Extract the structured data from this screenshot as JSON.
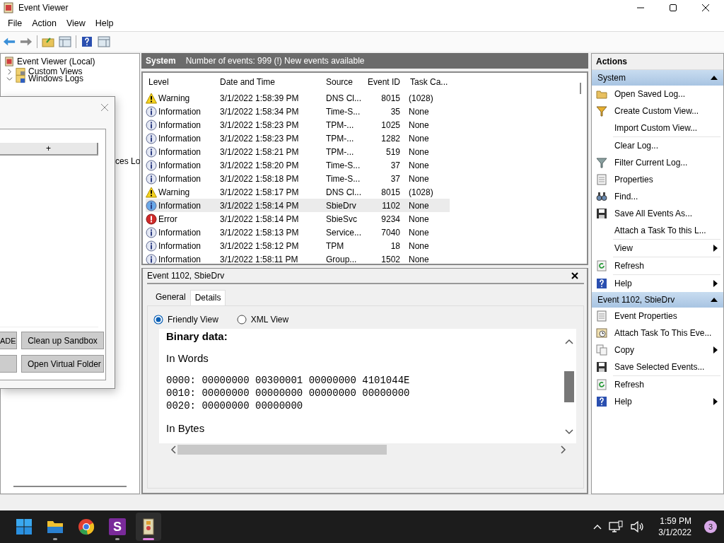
{
  "window": {
    "title": "Event Viewer"
  },
  "menu": [
    "File",
    "Action",
    "View",
    "Help"
  ],
  "tree": {
    "label": "Event Viewer (Local)",
    "children": [
      {
        "label": "Custom Views",
        "expanded": false
      },
      {
        "label": "Windows Logs",
        "expanded": true
      }
    ]
  },
  "tree_fragment": "ces Lo",
  "dialog": {
    "column_header": "+",
    "left_buttons": [
      "ADE"
    ],
    "right_buttons": [
      "Clean up Sandbox",
      "Open Virtual Folder"
    ]
  },
  "log": {
    "name": "System",
    "summary": "Number of events: 999 (!) New events available"
  },
  "table": {
    "columns": [
      "Level",
      "Date and Time",
      "Source",
      "Event ID",
      "Task Ca..."
    ],
    "rows": [
      {
        "kind": "warning",
        "level": "Warning",
        "date": "3/1/2022 1:58:39 PM",
        "source": "DNS Cl...",
        "event_id": "8015",
        "task": "(1028)",
        "selected": false
      },
      {
        "kind": "information",
        "level": "Information",
        "date": "3/1/2022 1:58:34 PM",
        "source": "Time-S...",
        "event_id": "35",
        "task": "None",
        "selected": false
      },
      {
        "kind": "information",
        "level": "Information",
        "date": "3/1/2022 1:58:23 PM",
        "source": "TPM-...",
        "event_id": "1025",
        "task": "None",
        "selected": false
      },
      {
        "kind": "information",
        "level": "Information",
        "date": "3/1/2022 1:58:23 PM",
        "source": "TPM-...",
        "event_id": "1282",
        "task": "None",
        "selected": false
      },
      {
        "kind": "information",
        "level": "Information",
        "date": "3/1/2022 1:58:21 PM",
        "source": "TPM-...",
        "event_id": "519",
        "task": "None",
        "selected": false
      },
      {
        "kind": "information",
        "level": "Information",
        "date": "3/1/2022 1:58:20 PM",
        "source": "Time-S...",
        "event_id": "37",
        "task": "None",
        "selected": false
      },
      {
        "kind": "information",
        "level": "Information",
        "date": "3/1/2022 1:58:18 PM",
        "source": "Time-S...",
        "event_id": "37",
        "task": "None",
        "selected": false
      },
      {
        "kind": "warning",
        "level": "Warning",
        "date": "3/1/2022 1:58:17 PM",
        "source": "DNS Cl...",
        "event_id": "8015",
        "task": "(1028)",
        "selected": false
      },
      {
        "kind": "information",
        "level": "Information",
        "date": "3/1/2022 1:58:14 PM",
        "source": "SbieDrv",
        "event_id": "1102",
        "task": "None",
        "selected": true
      },
      {
        "kind": "error",
        "level": "Error",
        "date": "3/1/2022 1:58:14 PM",
        "source": "SbieSvc",
        "event_id": "9234",
        "task": "None",
        "selected": false
      },
      {
        "kind": "information",
        "level": "Information",
        "date": "3/1/2022 1:58:13 PM",
        "source": "Service...",
        "event_id": "7040",
        "task": "None",
        "selected": false
      },
      {
        "kind": "information",
        "level": "Information",
        "date": "3/1/2022 1:58:12 PM",
        "source": "TPM",
        "event_id": "18",
        "task": "None",
        "selected": false
      },
      {
        "kind": "information",
        "level": "Information",
        "date": "3/1/2022 1:58:11 PM",
        "source": "Group...",
        "event_id": "1502",
        "task": "None",
        "selected": false
      }
    ]
  },
  "details": {
    "title": "Event 1102, SbieDrv",
    "tabs": [
      {
        "label": "General",
        "selected": false
      },
      {
        "label": "Details",
        "selected": true
      }
    ],
    "views": [
      {
        "label": "Friendly View",
        "selected": true
      },
      {
        "label": "XML View",
        "selected": false
      }
    ],
    "heading": "Binary data:",
    "sections": [
      {
        "title": "In Words",
        "lines": [
          "0000: 00000000 00300001 00000000 4101044E",
          "0010: 00000000 00000000 00000000 00000000",
          "0020: 00000000 00000000"
        ]
      },
      {
        "title": "In Bytes"
      }
    ]
  },
  "actions": {
    "title": "Actions",
    "groups": [
      {
        "title": "System",
        "expanded": true,
        "items": [
          {
            "label": "Open Saved Log...",
            "kind": "folder"
          },
          {
            "label": "Create Custom View...",
            "kind": "filter"
          },
          {
            "label": "Import Custom View...",
            "kind": "plain",
            "separator": true
          },
          {
            "label": "Clear Log...",
            "kind": "plain"
          },
          {
            "label": "Filter Current Log...",
            "kind": "filter-gray"
          },
          {
            "label": "Properties",
            "kind": "properties"
          },
          {
            "label": "Find...",
            "kind": "find"
          },
          {
            "label": "Save All Events As...",
            "kind": "save"
          },
          {
            "label": "Attach a Task To this L...",
            "kind": "plain",
            "separator": true
          },
          {
            "label": "View",
            "kind": "plain",
            "submenu": true,
            "separator": true
          },
          {
            "label": "Refresh",
            "kind": "refresh",
            "separator": true
          },
          {
            "label": "Help",
            "kind": "help",
            "submenu": true
          }
        ]
      },
      {
        "title": "Event 1102, SbieDrv",
        "expanded": true,
        "items": [
          {
            "label": "Event Properties",
            "kind": "properties"
          },
          {
            "label": "Attach Task To This Eve...",
            "kind": "task"
          },
          {
            "label": "Copy",
            "kind": "copy",
            "submenu": true
          },
          {
            "label": "Save Selected Events...",
            "kind": "save",
            "separator": true
          },
          {
            "label": "Refresh",
            "kind": "refresh"
          },
          {
            "label": "Help",
            "kind": "help",
            "submenu": true
          }
        ]
      }
    ]
  },
  "taskbar": {
    "apps": [
      {
        "kind": "start",
        "running": false,
        "active": false
      },
      {
        "kind": "folder",
        "running": true,
        "active": false
      },
      {
        "kind": "browser",
        "running": false,
        "active": false
      },
      {
        "kind": "letter",
        "letter": "S",
        "running": true,
        "active": false
      },
      {
        "kind": "viewer",
        "running": true,
        "active": true
      }
    ],
    "time": "1:59 PM",
    "date": "3/1/2022",
    "badge": "3"
  }
}
